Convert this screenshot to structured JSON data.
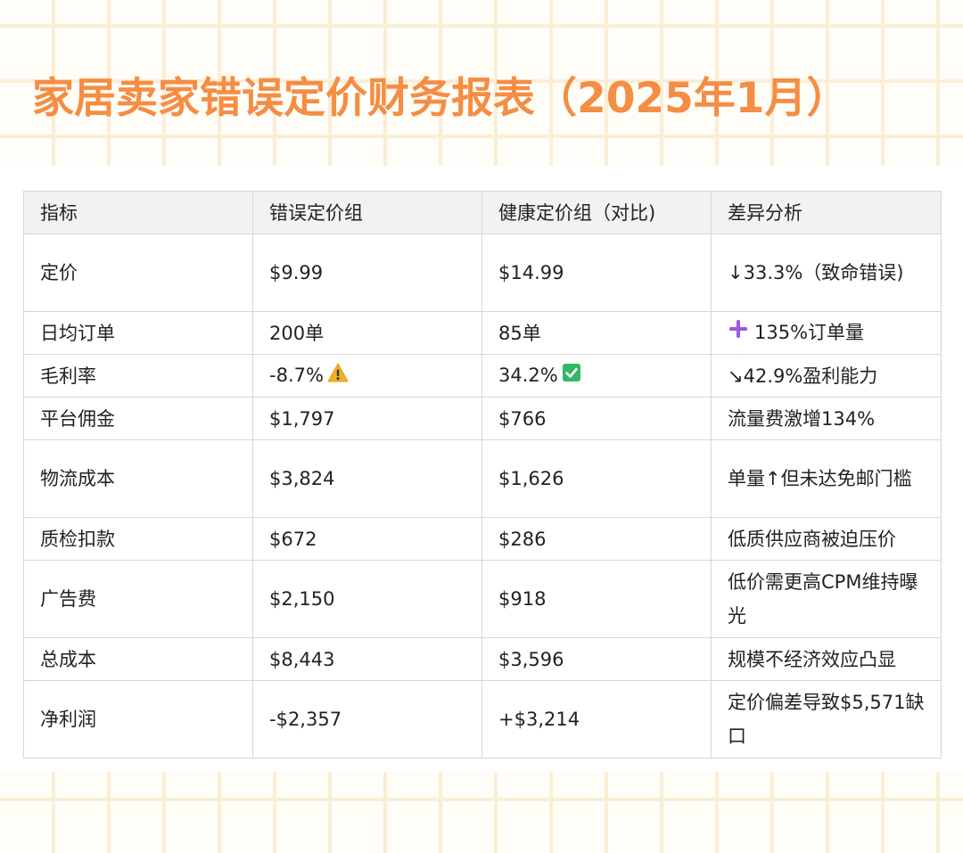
{
  "title": "家居卖家错误定价财务报表（2025年1月）",
  "colors": {
    "title": "#f58d44",
    "header_bg": "#f1f2f4",
    "warning": "#f2b01e",
    "check": "#2fb866",
    "plus": "#9b59e6"
  },
  "table": {
    "headers": [
      "指标",
      "错误定价组",
      "健康定价组（对比)",
      "差异分析"
    ],
    "rows": [
      {
        "metric": "定价",
        "error": "$9.99",
        "healthy": "$14.99",
        "analysis": "↓33.3%（致命错误)"
      },
      {
        "metric": "日均订单",
        "error": "200单",
        "healthy": "85单",
        "analysis": "135%订单量",
        "analysis_icon": "plus-icon"
      },
      {
        "metric": "毛利率",
        "error": "-8.7%",
        "error_icon": "warning-icon",
        "healthy": "34.2%",
        "healthy_icon": "check-icon",
        "analysis": "↘42.9%盈利能力"
      },
      {
        "metric": "平台佣金",
        "error": "$1,797",
        "healthy": "$766",
        "analysis": "流量费激增134%"
      },
      {
        "metric": "物流成本",
        "error": "$3,824",
        "healthy": "$1,626",
        "analysis": "单量↑但未达免邮门槛"
      },
      {
        "metric": "质检扣款",
        "error": "$672",
        "healthy": "$286",
        "analysis": "低质供应商被迫压价"
      },
      {
        "metric": "广告费",
        "error": "$2,150",
        "healthy": "$918",
        "analysis": "低价需更高CPM维持曝光"
      },
      {
        "metric": "总成本",
        "error": "$8,443",
        "healthy": "$3,596",
        "analysis": "规模不经济效应凸显"
      },
      {
        "metric": "净利润",
        "error": "-$2,357",
        "healthy": "+$3,214",
        "analysis": "定价偏差导致$5,571缺口"
      }
    ]
  }
}
